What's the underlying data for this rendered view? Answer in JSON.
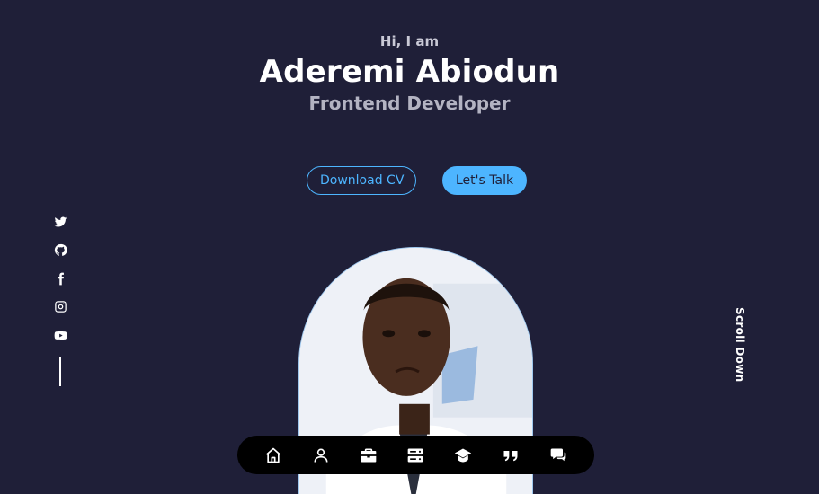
{
  "header": {
    "greeting": "Hi, I am",
    "name": "Aderemi Abiodun",
    "role": "Frontend Developer"
  },
  "cta": {
    "download_label": "Download CV",
    "talk_label": "Let's Talk"
  },
  "socials": [
    {
      "icon": "twitter-icon"
    },
    {
      "icon": "github-icon"
    },
    {
      "icon": "facebook-icon"
    },
    {
      "icon": "instagram-icon"
    },
    {
      "icon": "youtube-icon"
    }
  ],
  "scroll_label": "Scroll Down",
  "nav": [
    {
      "icon": "home-icon"
    },
    {
      "icon": "user-icon"
    },
    {
      "icon": "briefcase-icon"
    },
    {
      "icon": "server-icon"
    },
    {
      "icon": "graduation-cap-icon"
    },
    {
      "icon": "quote-icon"
    },
    {
      "icon": "messages-icon"
    }
  ],
  "colors": {
    "background": "#1f1f38",
    "accent": "#4db5ff",
    "nav_background": "#000000"
  }
}
